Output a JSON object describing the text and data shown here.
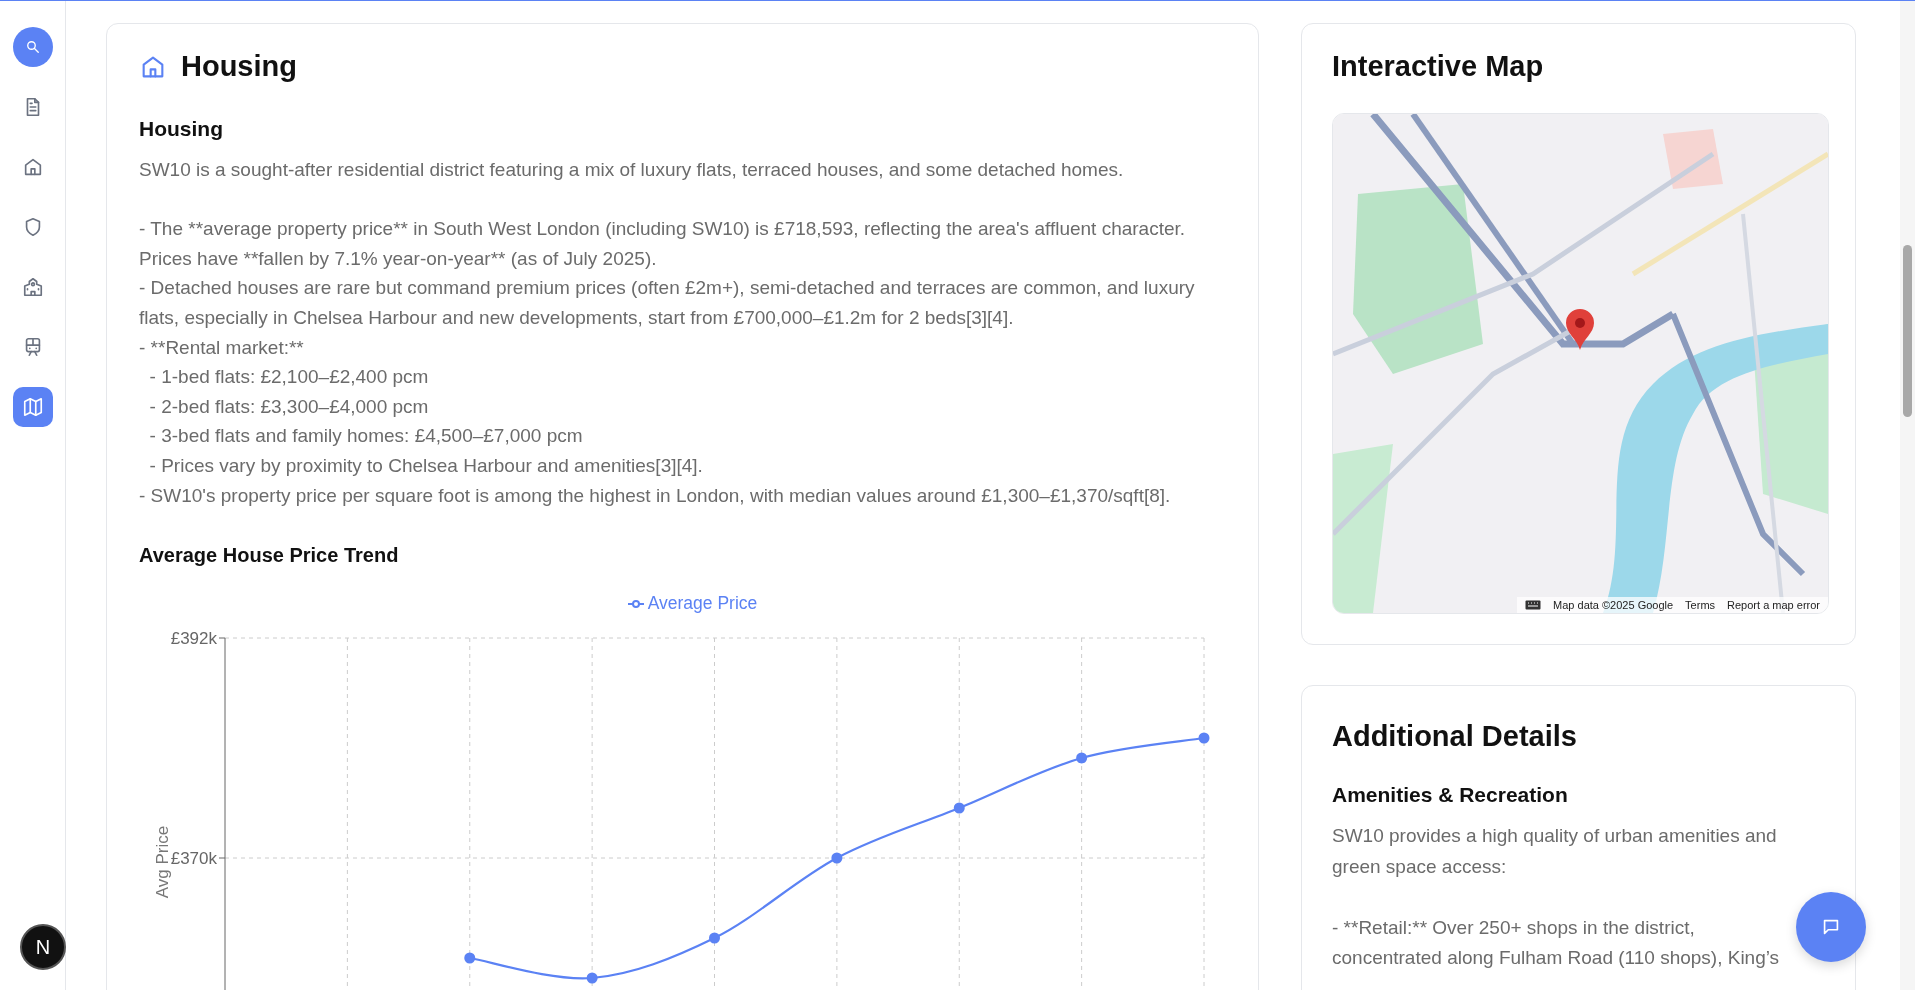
{
  "sidebar": {
    "items": [
      {
        "selected": false
      },
      {
        "selected": false
      },
      {
        "selected": false
      },
      {
        "selected": false
      },
      {
        "selected": false
      },
      {
        "selected": true
      }
    ]
  },
  "dev_badge": "N",
  "housing": {
    "title": "Housing",
    "subtitle": "Housing",
    "body": "SW10 is a sought-after residential district featuring a mix of luxury flats, terraced houses, and some detached homes.\n\n- The **average property price** in South West London (including SW10) is £718,593, reflecting the area's affluent character. Prices have **fallen by 7.1% year-on-year** (as of July 2025).\n- Detached houses are rare but command premium prices (often £2m+), semi-detached and terraces are common, and luxury flats, especially in Chelsea Harbour and new developments, start from £700,000–£1.2m for 2 beds[3][4].\n- **Rental market:**\n  - 1-bed flats: £2,100–£2,400 pcm\n  - 2-bed flats: £3,300–£4,000 pcm\n  - 3-bed flats and family homes: £4,500–£7,000 pcm\n  - Prices vary by proximity to Chelsea Harbour and amenities[3][4].\n- SW10's property price per square foot is among the highest in London, with median values around £1,300–£1,370/sqft[8].",
    "chart": {
      "title": "Average House Price Trend",
      "chart_data": {
        "type": "line",
        "ylabel": "Avg Price",
        "grid": true,
        "series": [
          {
            "name": "Average Price",
            "color": "#5b82f4",
            "marker": "circle",
            "values": [
              null,
              null,
              360,
              358,
              362,
              370,
              375,
              380,
              382
            ]
          }
        ],
        "ylim": [
          348,
          392
        ],
        "yticks": [
          {
            "value": 370,
            "label": "£370k"
          },
          {
            "value": 392,
            "label": "£392k"
          }
        ]
      }
    }
  },
  "map": {
    "title": "Interactive Map",
    "attribution": "Map data ©2025 Google",
    "links": [
      "Terms",
      "Report a map error"
    ]
  },
  "details": {
    "title": "Additional Details",
    "section": "Amenities & Recreation",
    "body": "SW10 provides a high quality of urban amenities and green space access:\n\n- **Retail:** Over 250+ shops in the district, concentrated along Fulham Road (110 shops), King’s"
  }
}
